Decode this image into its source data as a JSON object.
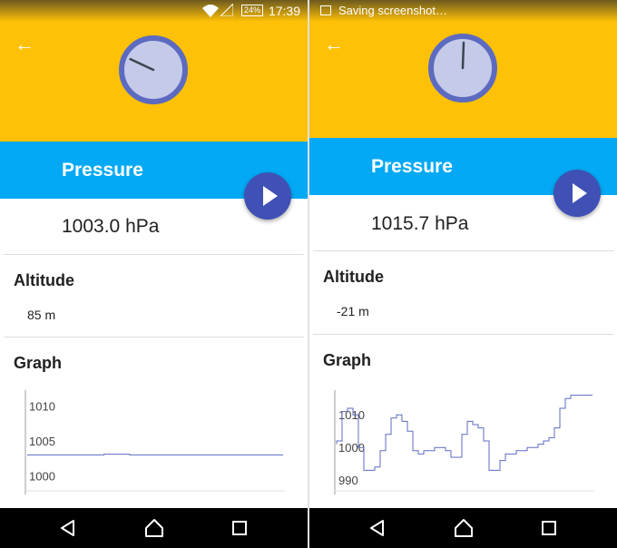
{
  "colors": {
    "header": "#FFC107",
    "band": "#03A9F4",
    "fab": "#3F51B5",
    "gauge": "#5C6BC0",
    "gauge_face": "#C5CAE9",
    "graph_line": "#5C6BC0"
  },
  "screens": [
    {
      "status": {
        "time": "17:39",
        "battery": "24%"
      },
      "title": "Pressure",
      "pressure": "1003.0 hPa",
      "altitude_label": "Altitude",
      "altitude_value": "85 m",
      "graph_label": "Graph",
      "gauge_angle_deg": -65,
      "chart_data": {
        "type": "line",
        "ytick_labels": [
          "1010",
          "1005",
          "1000"
        ],
        "yticks": [
          1010,
          1005,
          1000
        ],
        "ylim": [
          998,
          1012
        ],
        "x": [
          0,
          1,
          2,
          3,
          4,
          5,
          6,
          7,
          8,
          9,
          10
        ],
        "values": [
          1003.0,
          1003.0,
          1003.0,
          1003.0,
          1003.1,
          1003.0,
          1003.0,
          1003.0,
          1003.0,
          1003.0,
          1003.0
        ]
      }
    },
    {
      "status": {
        "notification": "Saving screenshot…"
      },
      "title": "Pressure",
      "pressure": "1015.7 hPa",
      "altitude_label": "Altitude",
      "altitude_value": "-21 m",
      "graph_label": "Graph",
      "gauge_angle_deg": 2,
      "chart_data": {
        "type": "line",
        "ytick_labels": [
          "1010",
          "1000",
          "990"
        ],
        "yticks": [
          1010,
          1000,
          990
        ],
        "ylim": [
          987,
          1017
        ],
        "x": [
          0,
          1,
          2,
          3,
          4,
          5,
          6,
          7,
          8,
          9,
          10,
          11,
          12,
          13,
          14,
          15,
          16,
          17,
          18,
          19,
          20,
          21,
          22,
          23,
          24,
          25,
          26,
          27,
          28,
          29,
          30,
          31,
          32,
          33,
          34,
          35,
          36,
          37,
          38,
          39,
          40,
          41,
          42,
          43,
          44,
          45,
          46,
          47
        ],
        "values": [
          1001,
          1002,
          1011,
          1012,
          1010,
          1000,
          993,
          993,
          994,
          999,
          1004,
          1009,
          1010,
          1008,
          1005,
          999,
          998,
          999,
          999,
          1000,
          1000,
          999,
          997,
          997,
          1004,
          1008,
          1007,
          1006,
          1002,
          993,
          993,
          996,
          998,
          998,
          999,
          999,
          1000,
          1000,
          1001,
          1002,
          1003,
          1006,
          1012,
          1015,
          1016,
          1016,
          1016,
          1016
        ]
      }
    }
  ]
}
